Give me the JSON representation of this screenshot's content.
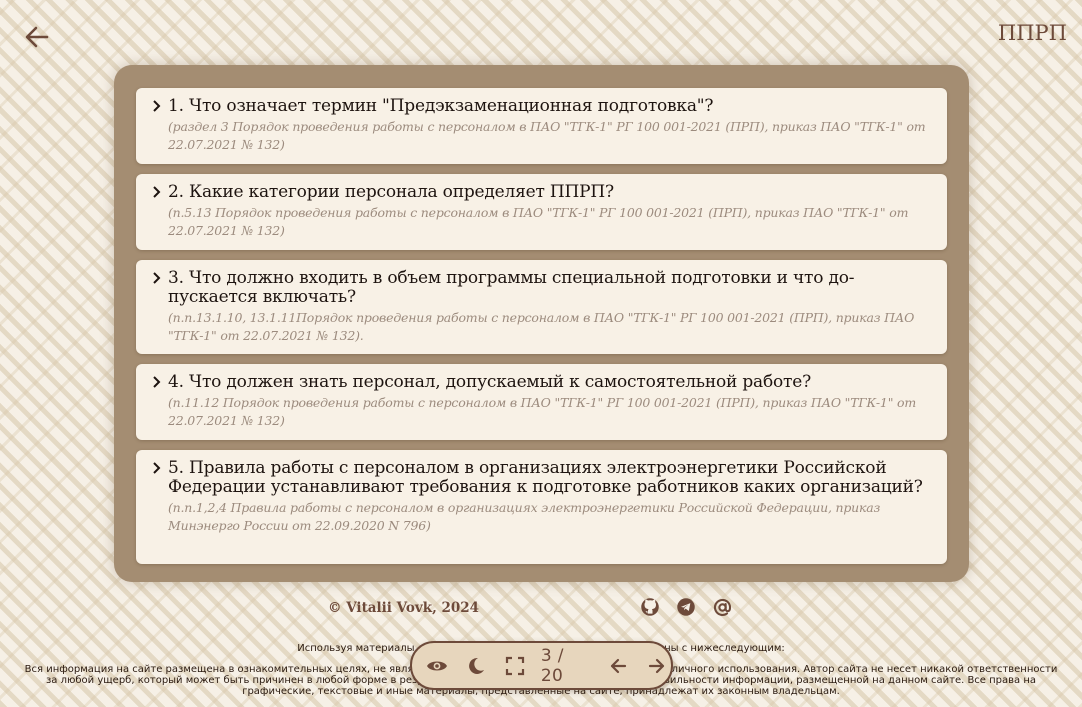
{
  "header": {
    "title": "ППРП",
    "back_icon": "arrow-left-icon"
  },
  "questions": [
    {
      "text": "1. Что означает термин \"Предэкзаменационная подготовка\"?",
      "ref": "(раздел 3 Порядок проведения работы с персоналом в ПАО \"ТГК-1\" РГ 100 001-2021 (ПРП), приказ ПАО \"ТГК-1\" от 22.07.2021 № 132)"
    },
    {
      "text": "2. Какие категории персонала определяет ППРП?",
      "ref": "(п.5.13 Порядок проведения работы с персоналом в ПАО \"ТГК-1\" РГ 100 001-2021 (ПРП), приказ ПАО \"ТГК-1\" от 22.07.2021 № 132)"
    },
    {
      "text": "3. Что должно входить в объем программы специальной подготовки и что до-пускается включать?",
      "ref": "(п.п.13.1.10, 13.1.11Порядок проведения работы с персоналом в ПАО \"ТГК-1\" РГ 100 001-2021 (ПРП), приказ ПАО \"ТГК-1\" от 22.07.2021 № 132)."
    },
    {
      "text": "4. Что должен знать персонал, допускаемый к самостоятельной работе?",
      "ref": "(п.11.12 Порядок проведения работы с персоналом в ПАО \"ТГК-1\" РГ 100 001-2021 (ПРП), приказ ПАО \"ТГК-1\" от 22.07.2021 № 132)"
    },
    {
      "text": "5. Правила работы с персоналом в организациях электроэнергетики Российской Федерации устанавливают требования к подготовке работников каких организаций?",
      "ref": "(п.п.1,2,4 Правила работы с персоналом в организациях электроэнергетики Российской Федерации, приказ Минэнерго России от 22.09.2020 N 796)"
    }
  ],
  "footer": {
    "copyright": "© Vitalii Vovk, 2024",
    "social": [
      "github-icon",
      "telegram-icon",
      "at-sign-icon"
    ],
    "disclaimer_head": "Используя материалы данного сайта, вы подтверждаете, что согласны с нижеследующим:",
    "disclaimer_body": "Вся информация на сайте размещена в ознакомительных целях, не является официальной и предназначена только для личного использования. Автор сайта не несет никакой ответственности за любой ущерб, который может быть причинен в любой форме в результате использования, неполноты или неправильности информации, размещенной на данном сайте. Все права на графические, текстовые и иные материалы, представленные на сайте, принадлежат их законным владельцам."
  },
  "toolbar": {
    "counter": "3 / 20",
    "buttons": [
      "eye-icon",
      "moon-icon",
      "fullscreen-icon",
      "arrow-left-icon",
      "arrow-right-icon"
    ]
  },
  "colors": {
    "accent": "#6d4a3a",
    "panel": "#a48d72",
    "card": "#f8f1e6",
    "reference_text": "#9c8b7e"
  }
}
